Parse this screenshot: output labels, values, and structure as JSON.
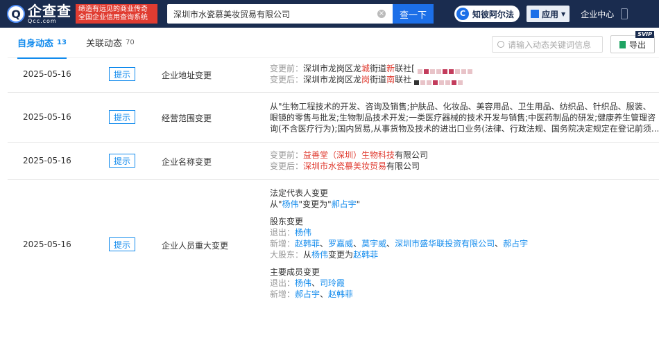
{
  "header": {
    "logo_glyph": "Q",
    "logo_main": "企查查",
    "logo_sub": "Qcc.com",
    "slogan": "缔造有远见的商业传奇 全国企业信用查询系统",
    "search_value": "深圳市水瓷慕美妆贸易有限公司",
    "search_button": "查一下",
    "zhibi_label": "知彼阿尔法",
    "app_label": "应用",
    "enterprise_center": "企业中心"
  },
  "tabs": [
    {
      "label": "自身动态",
      "count": "13"
    },
    {
      "label": "关联动态",
      "count": "70"
    }
  ],
  "keyword_placeholder": "请输入动态关键词信息",
  "export_label": "导出",
  "svip_label": "SVIP",
  "tag_label": "提示",
  "rows": [
    {
      "date": "2025-05-16",
      "type": "企业地址变更",
      "before_label": "变更前：",
      "before_a": "深圳市龙岗区龙",
      "before_red1": "城",
      "before_b": "街道",
      "before_red2": "新",
      "before_c": "联社[",
      "after_label": "变更后：",
      "after_a": "深圳市龙岗区龙",
      "after_red1": "岗",
      "after_b": "街道",
      "after_red2": "南",
      "after_c": "联社"
    },
    {
      "date": "2025-05-16",
      "type": "经营范围变更",
      "line1": "从\"生物工程技术的开发、咨询及销售;护肤品、化妆品、美容用品、卫生用品、纺织品、针织品、服装、",
      "line2": "眼镜的零售与批发;生物制品技术开发;一类医疗器械的技术开发与销售;中医药制品的研发;健康养生管理咨",
      "line3": "询(不含医疗行为);国内贸易,从事货物及技术的进出口业务(法律、行政法规、国务院决定规定在登记前须..."
    },
    {
      "date": "2025-05-16",
      "type": "企业名称变更",
      "before_label": "变更前：",
      "before_red": "益善堂（深圳）生物科技",
      "before_tail": "有限公司",
      "after_label": "变更后：",
      "after_red": "深圳市水瓷慕美妆贸易",
      "after_tail": "有限公司"
    },
    {
      "date": "2025-05-16",
      "type": "企业人员重大变更",
      "legal_title": "法定代表人变更",
      "legal_from": "从\"",
      "legal_old": "杨伟",
      "legal_mid": "\"变更为\"",
      "legal_new": "郝占宇",
      "legal_end": "\"",
      "holder_title": "股东变更",
      "exit_label": "退出：",
      "exit_name": "杨伟",
      "add_label": "新增：",
      "add_names": [
        "赵韩菲",
        "罗嘉威",
        "莫宇威",
        "深圳市盛华联投资有限公司",
        "郝占宇"
      ],
      "big_label": "大股东：",
      "big_from": "从",
      "big_old": "杨伟",
      "big_mid": "变更为",
      "big_new": "赵韩菲",
      "member_title": "主要成员变更",
      "m_exit_label": "退出：",
      "m_exit_names": [
        "杨伟",
        "司玲霞"
      ],
      "m_add_label": "新增：",
      "m_add_names": [
        "郝占宇",
        "赵韩菲"
      ]
    }
  ]
}
